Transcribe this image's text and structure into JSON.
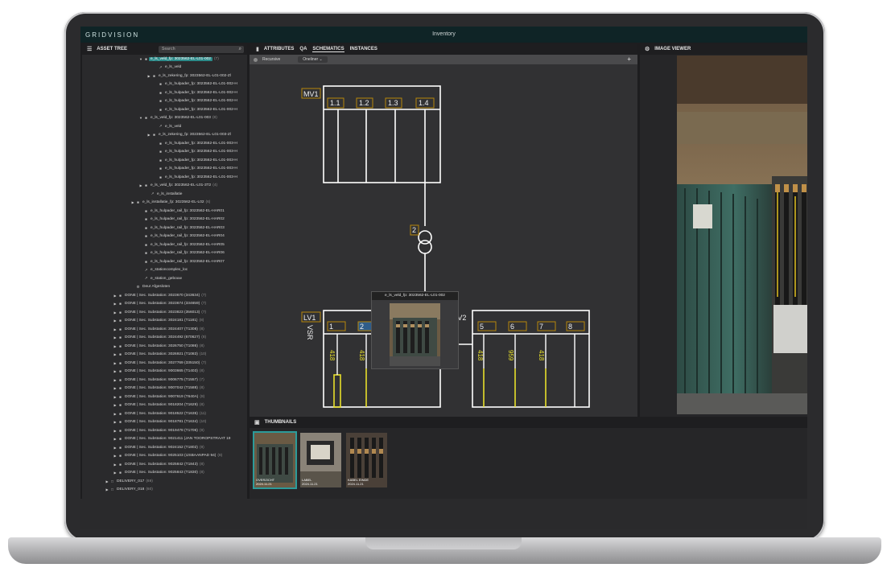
{
  "app": {
    "logo": "GRIDVISION",
    "title": "Inventory"
  },
  "asset_tree": {
    "header": "ASSET TREE",
    "search_placeholder": "Search",
    "rows": [
      {
        "indent": 70,
        "arrow": "▼",
        "icon": "■",
        "label": "e_ls_veld_fp: 3023562-EL-L01-002",
        "count": "(7)",
        "selected": true
      },
      {
        "indent": 88,
        "arrow": "",
        "icon": "↗",
        "label": "e_ls_veld",
        "count": ""
      },
      {
        "indent": 80,
        "arrow": "▶",
        "icon": "■",
        "label": "e_ls_zekering_fp: 3023562-EL-L01-002-Zl",
        "count": ""
      },
      {
        "indent": 88,
        "arrow": "",
        "icon": "■",
        "label": "e_ls_hulpader_fp: 3023562-EL-L01-002-H",
        "count": ""
      },
      {
        "indent": 88,
        "arrow": "",
        "icon": "■",
        "label": "e_ls_hulpader_fp: 3023562-EL-L01-002-H",
        "count": ""
      },
      {
        "indent": 88,
        "arrow": "",
        "icon": "■",
        "label": "e_ls_hulpader_fp: 3023562-EL-L01-002-H",
        "count": ""
      },
      {
        "indent": 88,
        "arrow": "",
        "icon": "■",
        "label": "e_ls_hulpader_fp: 3023562-EL-L01-002-H",
        "count": ""
      },
      {
        "indent": 70,
        "arrow": "▼",
        "icon": "■",
        "label": "e_ls_veld_fp: 3023562-EL-L01-003",
        "count": "(8)"
      },
      {
        "indent": 88,
        "arrow": "",
        "icon": "↗",
        "label": "e_ls_veld",
        "count": ""
      },
      {
        "indent": 80,
        "arrow": "▶",
        "icon": "■",
        "label": "e_ls_zekering_fp: 3023562-EL-L01-003-Zl",
        "count": ""
      },
      {
        "indent": 88,
        "arrow": "",
        "icon": "■",
        "label": "e_ls_hulpader_fp: 3023562-EL-L01-003-H",
        "count": ""
      },
      {
        "indent": 88,
        "arrow": "",
        "icon": "■",
        "label": "e_ls_hulpader_fp: 3023562-EL-L01-003-H",
        "count": ""
      },
      {
        "indent": 88,
        "arrow": "",
        "icon": "■",
        "label": "e_ls_hulpader_fp: 3023562-EL-L01-003-H",
        "count": ""
      },
      {
        "indent": 88,
        "arrow": "",
        "icon": "■",
        "label": "e_ls_hulpader_fp: 3023562-EL-L01-003-H",
        "count": ""
      },
      {
        "indent": 88,
        "arrow": "",
        "icon": "■",
        "label": "e_ls_hulpader_fp: 3023562-EL-L01-003-H",
        "count": ""
      },
      {
        "indent": 70,
        "arrow": "▶",
        "icon": "■",
        "label": "e_ls_veld_fp: 3023562-EL-L01-3T2",
        "count": "(4)"
      },
      {
        "indent": 78,
        "arrow": "",
        "icon": "↗",
        "label": "e_ls_installatie",
        "count": ""
      },
      {
        "indent": 60,
        "arrow": "▶",
        "icon": "■",
        "label": "e_ls_installatie_fp: 3023562-EL-L02",
        "count": "(6)"
      },
      {
        "indent": 70,
        "arrow": "",
        "icon": "■",
        "label": "e_ls_hulpader_rail_fp: 3023562-EL-HAR01",
        "count": ""
      },
      {
        "indent": 70,
        "arrow": "",
        "icon": "■",
        "label": "e_ls_hulpader_rail_fp: 3023562-EL-HAR02",
        "count": ""
      },
      {
        "indent": 70,
        "arrow": "",
        "icon": "■",
        "label": "e_ls_hulpader_rail_fp: 3023562-EL-HAR03",
        "count": ""
      },
      {
        "indent": 70,
        "arrow": "",
        "icon": "■",
        "label": "e_ls_hulpader_rail_fp: 3023562-EL-HAR04",
        "count": ""
      },
      {
        "indent": 70,
        "arrow": "",
        "icon": "■",
        "label": "e_ls_hulpader_rail_fp: 3023562-EL-HAR05",
        "count": ""
      },
      {
        "indent": 70,
        "arrow": "",
        "icon": "■",
        "label": "e_ls_hulpader_rail_fp: 3023562-EL-HAR06",
        "count": ""
      },
      {
        "indent": 70,
        "arrow": "",
        "icon": "■",
        "label": "e_ls_hulpader_rail_fp: 3023562-EL-HAR07",
        "count": ""
      },
      {
        "indent": 70,
        "arrow": "",
        "icon": "↗",
        "label": "e_stationcomplex_loc",
        "count": ""
      },
      {
        "indent": 70,
        "arrow": "",
        "icon": "↗",
        "label": "e_station_gebouw",
        "count": ""
      },
      {
        "indent": 60,
        "arrow": "",
        "icon": "⚙",
        "label": "Deur Afgesloten",
        "count": ""
      },
      {
        "indent": 38,
        "arrow": "▶",
        "icon": "■",
        "label": "DONE | Sec. Substation: 3023670 (343634)",
        "count": "(7)"
      },
      {
        "indent": 38,
        "arrow": "▶",
        "icon": "■",
        "label": "DONE | Sec. Substation: 3023674 (334659)",
        "count": "(7)"
      },
      {
        "indent": 38,
        "arrow": "▶",
        "icon": "■",
        "label": "DONE | Sec. Substation: 3023823 (356013)",
        "count": "(7)"
      },
      {
        "indent": 38,
        "arrow": "▶",
        "icon": "■",
        "label": "DONE | Sec. Substation: 3024181 (T1181)",
        "count": "(8)"
      },
      {
        "indent": 38,
        "arrow": "▶",
        "icon": "■",
        "label": "DONE | Sec. Substation: 3024407 (T1308)",
        "count": "(8)"
      },
      {
        "indent": 38,
        "arrow": "▶",
        "icon": "■",
        "label": "DONE | Sec. Substation: 3024492 (670627)",
        "count": "(8)"
      },
      {
        "indent": 38,
        "arrow": "▶",
        "icon": "■",
        "label": "DONE | Sec. Substation: 3026750 (T1086)",
        "count": "(8)"
      },
      {
        "indent": 38,
        "arrow": "▶",
        "icon": "■",
        "label": "DONE | Sec. Substation: 3026921 (T1083)",
        "count": "(10)"
      },
      {
        "indent": 38,
        "arrow": "▶",
        "icon": "■",
        "label": "DONE | Sec. Substation: 3027769 (335150)",
        "count": "(7)"
      },
      {
        "indent": 38,
        "arrow": "▶",
        "icon": "■",
        "label": "DONE | Sec. Substation: 9003665 (T1403)",
        "count": "(8)"
      },
      {
        "indent": 38,
        "arrow": "▶",
        "icon": "■",
        "label": "DONE | Sec. Substation: 9006775 (T1557)",
        "count": "(7)"
      },
      {
        "indent": 38,
        "arrow": "▶",
        "icon": "■",
        "label": "DONE | Sec. Substation: 9007042 (T1588)",
        "count": "(8)"
      },
      {
        "indent": 38,
        "arrow": "▶",
        "icon": "■",
        "label": "DONE | Sec. Substation: 9007619 (T640A)",
        "count": "(8)"
      },
      {
        "indent": 38,
        "arrow": "▶",
        "icon": "■",
        "label": "DONE | Sec. Substation: 9018204 (T1629)",
        "count": "(8)"
      },
      {
        "indent": 38,
        "arrow": "▶",
        "icon": "■",
        "label": "DONE | Sec. Substation: 9018522 (T1635)",
        "count": "(11)"
      },
      {
        "indent": 38,
        "arrow": "▶",
        "icon": "■",
        "label": "DONE | Sec. Substation: 9018781 (T1634)",
        "count": "(10)"
      },
      {
        "indent": 38,
        "arrow": "▶",
        "icon": "■",
        "label": "DONE | Sec. Substation: 9019478 (T1706)",
        "count": "(9)"
      },
      {
        "indent": 38,
        "arrow": "▶",
        "icon": "■",
        "label": "DONE | Sec. Substation: 9021411 (JAN TOOROPSTRAAT 19",
        "count": ""
      },
      {
        "indent": 38,
        "arrow": "▶",
        "icon": "■",
        "label": "DONE | Sec. Substation: 9024152 (T1802)",
        "count": "(9)"
      },
      {
        "indent": 38,
        "arrow": "▶",
        "icon": "■",
        "label": "DONE | Sec. Substation: 9025103 (IJSBAANPAD 94)",
        "count": "(8)"
      },
      {
        "indent": 38,
        "arrow": "▶",
        "icon": "■",
        "label": "DONE | Sec. Substation: 9025842 (T1843)",
        "count": "(8)"
      },
      {
        "indent": 38,
        "arrow": "▶",
        "icon": "■",
        "label": "DONE | Sec. Substation: 9025843 (T1830)",
        "count": "(8)"
      },
      {
        "indent": 28,
        "arrow": "▶",
        "icon": "□",
        "label": "DELIVERY_017",
        "count": "(69)"
      },
      {
        "indent": 28,
        "arrow": "▶",
        "icon": "□",
        "label": "DELIVERY_018",
        "count": "(60)"
      }
    ]
  },
  "center": {
    "tabs": [
      "ATTRIBUTES",
      "QA",
      "SCHEMATICS",
      "INSTANCES"
    ],
    "active_tab": "SCHEMATICS",
    "recursive_label": "Recursive",
    "view_select": "Oneliner",
    "schematic": {
      "mv_label": "MV1",
      "mv_fields": [
        "1.1",
        "1.2",
        "1.3",
        "1.4"
      ],
      "transformer_label": "2",
      "lv1_label": "LV1",
      "lv2_label": "LV2",
      "vsr_label": "VSR",
      "lv1_fields": [
        "1",
        "2"
      ],
      "lv2_fields": [
        "5",
        "6",
        "7",
        "8"
      ],
      "lv1_ratings": [
        "418",
        "418"
      ],
      "lv2_ratings": [
        "418",
        "959",
        "418"
      ],
      "tooltip": "e_ls_veld_fp: 3023562-EL-L01-002"
    }
  },
  "viewer": {
    "header": "IMAGE VIEWER"
  },
  "thumbnails": {
    "header": "THUMBNAILS",
    "items": [
      {
        "title": "OVERZICHT",
        "date": "2024.11.21",
        "active": true
      },
      {
        "title": "LABEL",
        "date": "2024.11.21",
        "active": false
      },
      {
        "title": "KABEL EINDE",
        "date": "2024.11.21",
        "active": false
      }
    ]
  },
  "colors": {
    "accent": "#2c9b9a",
    "schematic_line": "#ffffff",
    "highlight": "#e8e02a",
    "label_box": "#b8860b"
  }
}
